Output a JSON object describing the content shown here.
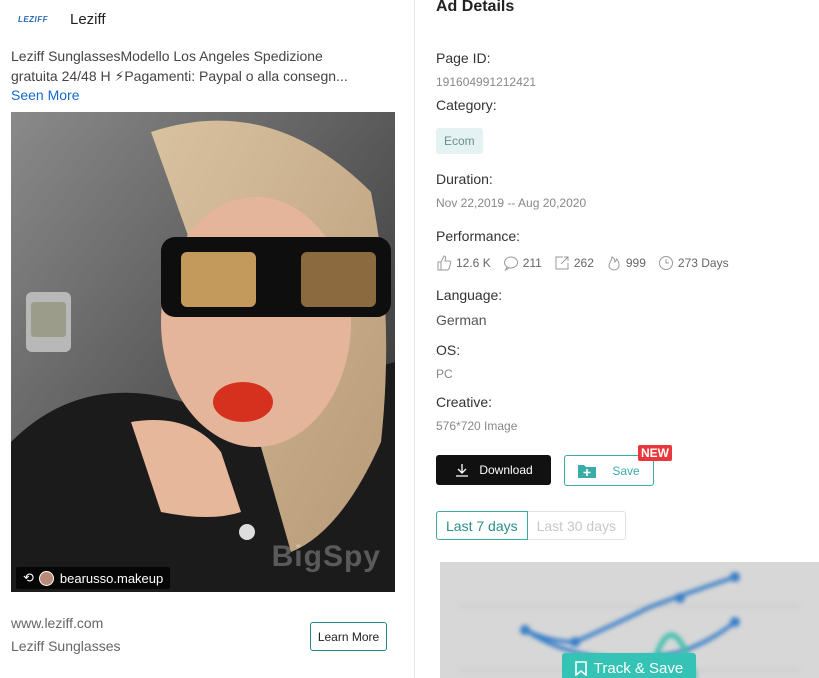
{
  "ad": {
    "brand_logo_text": "LEZIFF",
    "brand_name": "Leziff",
    "text_line1": "Leziff SunglassesModello Los Angeles Spedizione",
    "text_line2": "gratuita 24/48 H ⚡Pagamenti: Paypal o alla consegn...",
    "seen_more": "Seen More",
    "image": {
      "handle": "bearusso.makeup",
      "watermark": "BigSpy",
      "repost_icon": "repost-icon"
    },
    "domain": "www.leziff.com",
    "page_label": "Leziff Sunglasses",
    "cta": "Learn More"
  },
  "details": {
    "title": "Ad Details",
    "page_id_label": "Page ID:",
    "page_id": "191604991212421",
    "category_label": "Category:",
    "category": "Ecom",
    "duration_label": "Duration:",
    "duration": "Nov 22,2019 -- Aug 20,2020",
    "performance_label": "Performance:",
    "performance": {
      "likes": "12.6 K",
      "comments": "211",
      "shares": "262",
      "reactions": "999",
      "days": "273 Days"
    },
    "language_label": "Language:",
    "language": "German",
    "os_label": "OS:",
    "os": "PC",
    "creative_label": "Creative:",
    "creative": "576*720 Image",
    "download_label": "Download",
    "save_label": "Save",
    "new_badge": "NEW",
    "tabs": [
      "Last 7 days",
      "Last 30 days"
    ],
    "track_save_label": "Track & Save"
  },
  "colors": {
    "accent": "#3aaca8",
    "link": "#1769c9",
    "badge": "#e8383b",
    "track_button": "#34c3b4"
  }
}
